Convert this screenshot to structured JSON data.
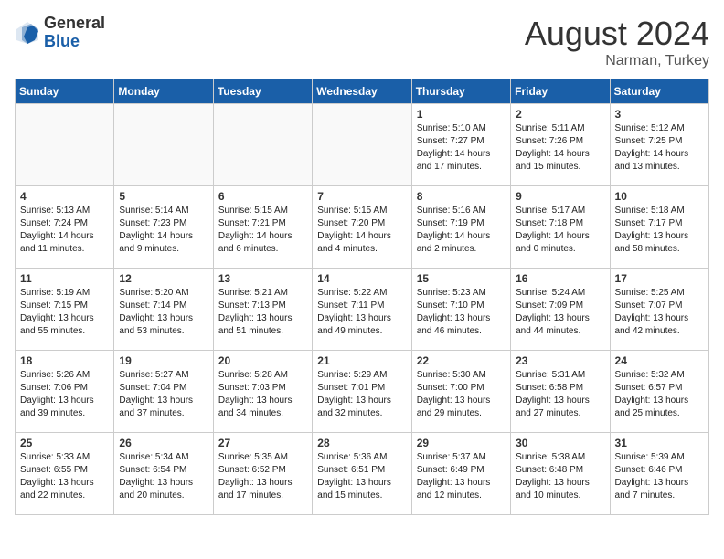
{
  "header": {
    "logo_general": "General",
    "logo_blue": "Blue",
    "month_year": "August 2024",
    "location": "Narman, Turkey"
  },
  "days_of_week": [
    "Sunday",
    "Monday",
    "Tuesday",
    "Wednesday",
    "Thursday",
    "Friday",
    "Saturday"
  ],
  "weeks": [
    [
      {
        "day": "",
        "info": ""
      },
      {
        "day": "",
        "info": ""
      },
      {
        "day": "",
        "info": ""
      },
      {
        "day": "",
        "info": ""
      },
      {
        "day": "1",
        "info": "Sunrise: 5:10 AM\nSunset: 7:27 PM\nDaylight: 14 hours\nand 17 minutes."
      },
      {
        "day": "2",
        "info": "Sunrise: 5:11 AM\nSunset: 7:26 PM\nDaylight: 14 hours\nand 15 minutes."
      },
      {
        "day": "3",
        "info": "Sunrise: 5:12 AM\nSunset: 7:25 PM\nDaylight: 14 hours\nand 13 minutes."
      }
    ],
    [
      {
        "day": "4",
        "info": "Sunrise: 5:13 AM\nSunset: 7:24 PM\nDaylight: 14 hours\nand 11 minutes."
      },
      {
        "day": "5",
        "info": "Sunrise: 5:14 AM\nSunset: 7:23 PM\nDaylight: 14 hours\nand 9 minutes."
      },
      {
        "day": "6",
        "info": "Sunrise: 5:15 AM\nSunset: 7:21 PM\nDaylight: 14 hours\nand 6 minutes."
      },
      {
        "day": "7",
        "info": "Sunrise: 5:15 AM\nSunset: 7:20 PM\nDaylight: 14 hours\nand 4 minutes."
      },
      {
        "day": "8",
        "info": "Sunrise: 5:16 AM\nSunset: 7:19 PM\nDaylight: 14 hours\nand 2 minutes."
      },
      {
        "day": "9",
        "info": "Sunrise: 5:17 AM\nSunset: 7:18 PM\nDaylight: 14 hours\nand 0 minutes."
      },
      {
        "day": "10",
        "info": "Sunrise: 5:18 AM\nSunset: 7:17 PM\nDaylight: 13 hours\nand 58 minutes."
      }
    ],
    [
      {
        "day": "11",
        "info": "Sunrise: 5:19 AM\nSunset: 7:15 PM\nDaylight: 13 hours\nand 55 minutes."
      },
      {
        "day": "12",
        "info": "Sunrise: 5:20 AM\nSunset: 7:14 PM\nDaylight: 13 hours\nand 53 minutes."
      },
      {
        "day": "13",
        "info": "Sunrise: 5:21 AM\nSunset: 7:13 PM\nDaylight: 13 hours\nand 51 minutes."
      },
      {
        "day": "14",
        "info": "Sunrise: 5:22 AM\nSunset: 7:11 PM\nDaylight: 13 hours\nand 49 minutes."
      },
      {
        "day": "15",
        "info": "Sunrise: 5:23 AM\nSunset: 7:10 PM\nDaylight: 13 hours\nand 46 minutes."
      },
      {
        "day": "16",
        "info": "Sunrise: 5:24 AM\nSunset: 7:09 PM\nDaylight: 13 hours\nand 44 minutes."
      },
      {
        "day": "17",
        "info": "Sunrise: 5:25 AM\nSunset: 7:07 PM\nDaylight: 13 hours\nand 42 minutes."
      }
    ],
    [
      {
        "day": "18",
        "info": "Sunrise: 5:26 AM\nSunset: 7:06 PM\nDaylight: 13 hours\nand 39 minutes."
      },
      {
        "day": "19",
        "info": "Sunrise: 5:27 AM\nSunset: 7:04 PM\nDaylight: 13 hours\nand 37 minutes."
      },
      {
        "day": "20",
        "info": "Sunrise: 5:28 AM\nSunset: 7:03 PM\nDaylight: 13 hours\nand 34 minutes."
      },
      {
        "day": "21",
        "info": "Sunrise: 5:29 AM\nSunset: 7:01 PM\nDaylight: 13 hours\nand 32 minutes."
      },
      {
        "day": "22",
        "info": "Sunrise: 5:30 AM\nSunset: 7:00 PM\nDaylight: 13 hours\nand 29 minutes."
      },
      {
        "day": "23",
        "info": "Sunrise: 5:31 AM\nSunset: 6:58 PM\nDaylight: 13 hours\nand 27 minutes."
      },
      {
        "day": "24",
        "info": "Sunrise: 5:32 AM\nSunset: 6:57 PM\nDaylight: 13 hours\nand 25 minutes."
      }
    ],
    [
      {
        "day": "25",
        "info": "Sunrise: 5:33 AM\nSunset: 6:55 PM\nDaylight: 13 hours\nand 22 minutes."
      },
      {
        "day": "26",
        "info": "Sunrise: 5:34 AM\nSunset: 6:54 PM\nDaylight: 13 hours\nand 20 minutes."
      },
      {
        "day": "27",
        "info": "Sunrise: 5:35 AM\nSunset: 6:52 PM\nDaylight: 13 hours\nand 17 minutes."
      },
      {
        "day": "28",
        "info": "Sunrise: 5:36 AM\nSunset: 6:51 PM\nDaylight: 13 hours\nand 15 minutes."
      },
      {
        "day": "29",
        "info": "Sunrise: 5:37 AM\nSunset: 6:49 PM\nDaylight: 13 hours\nand 12 minutes."
      },
      {
        "day": "30",
        "info": "Sunrise: 5:38 AM\nSunset: 6:48 PM\nDaylight: 13 hours\nand 10 minutes."
      },
      {
        "day": "31",
        "info": "Sunrise: 5:39 AM\nSunset: 6:46 PM\nDaylight: 13 hours\nand 7 minutes."
      }
    ]
  ]
}
